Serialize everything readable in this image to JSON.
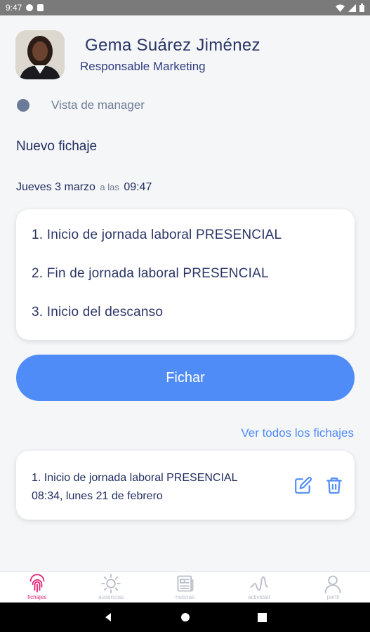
{
  "status_bar": {
    "time": "9:47"
  },
  "profile": {
    "name": "Gema Suárez Jiménez",
    "role": "Responsable Marketing"
  },
  "manager_view": {
    "label": "Vista de manager"
  },
  "new_entry": {
    "title": "Nuevo fichaje"
  },
  "date": {
    "day": "Jueves 3 marzo",
    "connector": "a las",
    "time": "09:47"
  },
  "options": [
    {
      "label": "1. Inicio de jornada laboral PRESENCIAL"
    },
    {
      "label": "2. Fin de jornada laboral PRESENCIAL"
    },
    {
      "label": "3. Inicio del descanso"
    }
  ],
  "fichar_button": {
    "label": "Fichar"
  },
  "ver_todos": {
    "label": "Ver todos los fichajes"
  },
  "last_record": {
    "type": "1. Inicio de jornada laboral PRESENCIAL",
    "datetime": "08:34, lunes 21 de febrero"
  },
  "nav": [
    {
      "label": "fichajes",
      "icon": "fingerprint-icon",
      "active": true
    },
    {
      "label": "ausencias",
      "icon": "sun-icon",
      "active": false
    },
    {
      "label": "noticias",
      "icon": "newspaper-icon",
      "active": false
    },
    {
      "label": "actividad",
      "icon": "activity-icon",
      "active": false
    },
    {
      "label": "perfil",
      "icon": "person-icon",
      "active": false
    }
  ],
  "colors": {
    "accent": "#4f8cf7",
    "active_nav": "#e02b7a",
    "text": "#2a3566"
  }
}
